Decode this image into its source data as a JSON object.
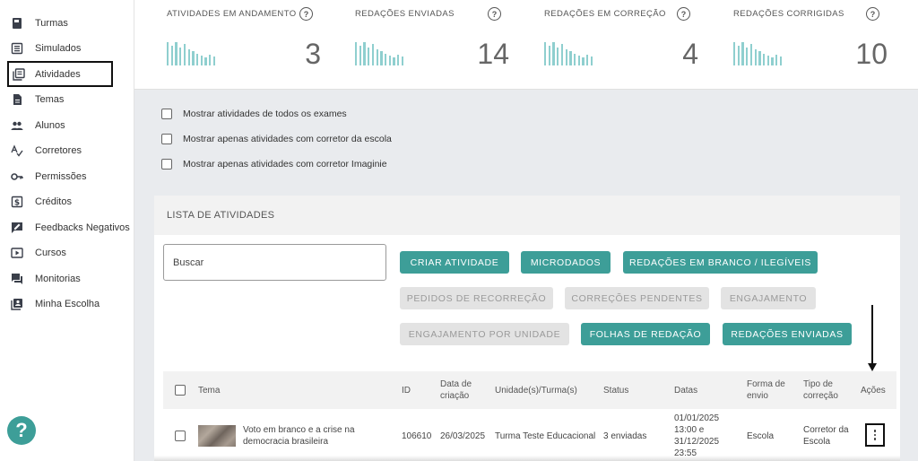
{
  "sidebar": {
    "items": [
      {
        "label": "Turmas",
        "icon": "book-icon"
      },
      {
        "label": "Simulados",
        "icon": "list-icon"
      },
      {
        "label": "Atividades",
        "icon": "library-icon",
        "active": true
      },
      {
        "label": "Temas",
        "icon": "document-icon"
      },
      {
        "label": "Alunos",
        "icon": "people-icon"
      },
      {
        "label": "Corretores",
        "icon": "spellcheck-icon"
      },
      {
        "label": "Permissões",
        "icon": "key-icon"
      },
      {
        "label": "Créditos",
        "icon": "dollar-icon"
      },
      {
        "label": "Feedbacks Negativos",
        "icon": "feedback-icon"
      },
      {
        "label": "Cursos",
        "icon": "video-icon"
      },
      {
        "label": "Monitorias",
        "icon": "forum-icon"
      },
      {
        "label": "Minha Escolha",
        "icon": "contact-icon"
      }
    ],
    "help_label": "?"
  },
  "stats": [
    {
      "label": "ATIVIDADES EM ANDAMENTO",
      "value": "3"
    },
    {
      "label": "REDAÇÕES ENVIADAS",
      "value": "14"
    },
    {
      "label": "REDAÇÕES EM CORREÇÃO",
      "value": "4"
    },
    {
      "label": "REDAÇÕES CORRIGIDAS",
      "value": "10"
    }
  ],
  "help_icon_text": "?",
  "filters": [
    "Mostrar atividades de todos os exames",
    "Mostrar apenas atividades com corretor da escola",
    "Mostrar apenas atividades com corretor Imaginie"
  ],
  "panel": {
    "title": "LISTA DE ATIVIDADES",
    "search_placeholder": "Buscar",
    "buttons": {
      "criar": "CRIAR ATIVIDADE",
      "microdados": "MICRODADOS",
      "branco": "REDAÇÕES EM BRANCO / ILEGÍVEIS",
      "recorrecao": "PEDIDOS DE RECORREÇÃO",
      "pendentes": "CORREÇÕES PENDENTES",
      "engajamento": "ENGAJAMENTO",
      "engajamento_unidade": "ENGAJAMENTO POR UNIDADE",
      "folhas": "FOLHAS DE REDAÇÃO",
      "enviadas": "REDAÇÕES ENVIADAS"
    }
  },
  "table": {
    "headers": {
      "tema": "Tema",
      "id": "ID",
      "data_criacao_1": "Data de",
      "data_criacao_2": "criação",
      "unidade": "Unidade(s)/Turma(s)",
      "status": "Status",
      "datas": "Datas",
      "forma_1": "Forma de",
      "forma_2": "envio",
      "tipo_1": "Tipo de",
      "tipo_2": "correção",
      "acoes": "Ações"
    },
    "row": {
      "tema_1": "Voto em branco e a crise na",
      "tema_2": "democracia brasileira",
      "id": "106610",
      "data_criacao": "26/03/2025",
      "unidade": "Turma Teste Educacional",
      "status": "3 enviadas",
      "datas_1": "01/01/2025",
      "datas_2": "13:00 e",
      "datas_3": "31/12/2025",
      "datas_4": "23:55",
      "forma": "Escola",
      "tipo_1": "Corretor da",
      "tipo_2": "Escola"
    }
  },
  "colors": {
    "primary": "#3d9e98",
    "bars": "#8fcfcf"
  }
}
